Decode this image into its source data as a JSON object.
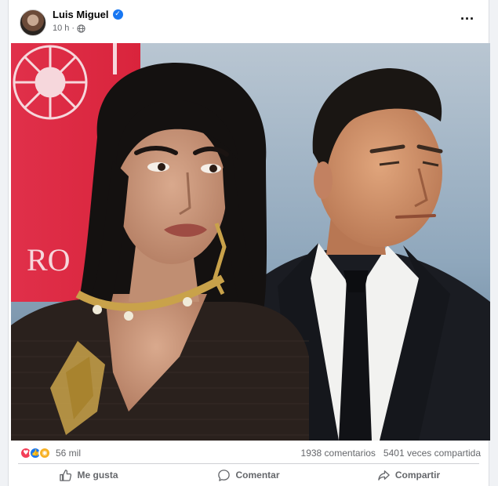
{
  "post": {
    "author": "Luis Miguel",
    "time": "10 h",
    "separator": "·",
    "more_label": "···"
  },
  "image": {
    "backdrop_text": "RO"
  },
  "stats": {
    "reactions_count": "56 mil",
    "comments": "1938 comentarios",
    "shares": "5401 veces compartida"
  },
  "actions": {
    "like": "Me gusta",
    "comment": "Comentar",
    "share": "Compartir"
  },
  "colors": {
    "accent": "#1877f2",
    "love": "#f33e58",
    "wow": "#f7b125"
  }
}
